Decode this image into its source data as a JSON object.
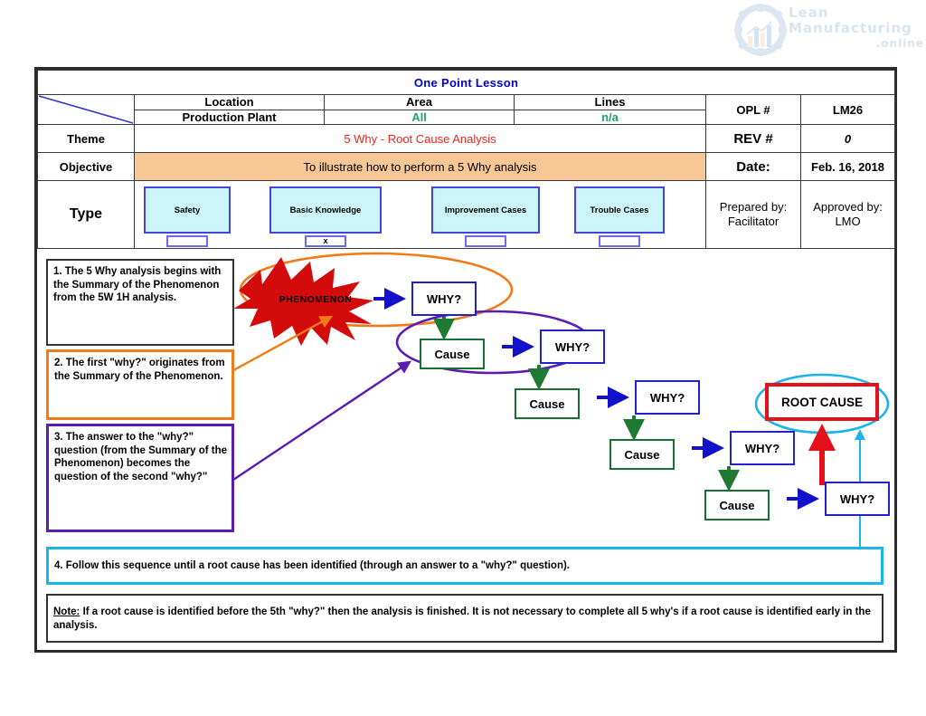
{
  "watermark": {
    "line1": "Lean",
    "line2": "Manufacturing",
    "line3": ".online",
    "icon": "gear-bar-chart-logo"
  },
  "header": {
    "title": "One Point Lesson",
    "columns": [
      {
        "label": "Location",
        "value": "Production Plant",
        "value_color": "#000000"
      },
      {
        "label": "Area",
        "value": "All",
        "value_color": "#22A06B"
      },
      {
        "label": "Lines",
        "value": "n/a",
        "value_color": "#22A06B"
      }
    ],
    "opl_label": "OPL #",
    "opl_value": "LM26",
    "rev_label": "REV #",
    "rev_value": "0",
    "date_label": "Date:",
    "date_value": "Feb. 16, 2018",
    "theme_label": "Theme",
    "theme_value": "5 Why - Root Cause Analysis",
    "objective_label": "Objective",
    "objective_value": "To illustrate how to perform a 5 Why analysis",
    "type_label": "Type",
    "prepared_by_label": "Prepared by:",
    "prepared_by_value": "Facilitator",
    "approved_by_label": "Approved by:",
    "approved_by_value": "LMO",
    "types": [
      {
        "label": "Safety",
        "checked": ""
      },
      {
        "label": "Basic Knowledge",
        "checked": "x"
      },
      {
        "label": "Improvement Cases",
        "checked": ""
      },
      {
        "label": "Trouble Cases",
        "checked": ""
      }
    ]
  },
  "steps": {
    "step1": "1.  The 5 Why analysis begins with the Summary of the Phenomenon from the 5W 1H analysis.",
    "step2": "2.  The first \"why?\" originates from the Summary of the Phenomenon.",
    "step3": "3.  The answer to the \"why?\" question (from the Summary of the Phenomenon) becomes the question of the second \"why?\"",
    "step4": "4.  Follow this sequence until a root cause has been identified (through an answer to a \"why?\" question).",
    "note_label": "Note:",
    "note_text": "  If a root cause is identified before the 5th \"why?\" then the analysis is finished.  It is not necessary to complete all 5 why's if a root cause is identified early in the analysis."
  },
  "diagram": {
    "phenomenon": "PHENOMENON",
    "why1": "WHY?",
    "cause1": "Cause",
    "why2": "WHY?",
    "cause2": "Cause",
    "why3": "WHY?",
    "cause3": "Cause",
    "why4": "WHY?",
    "cause4": "Cause",
    "why5": "WHY?",
    "root_cause": "ROOT CAUSE"
  },
  "colors": {
    "title_blue": "#0000CC",
    "theme_red": "#E8261C",
    "objective_bg": "#F7C795",
    "type_box_bg": "#CCF5FA",
    "type_box_border": "#4444DD",
    "green_value": "#22A06B",
    "orange": "#F07B18",
    "purple": "#5B1DB0",
    "cyan": "#1BB4EA",
    "starburst_red": "#D40B0B",
    "root_red": "#E4101A",
    "why_blue": "#2222CC",
    "cause_green": "#17702F",
    "arrow_blue": "#1111CC",
    "arrow_green": "#1E7A32"
  }
}
